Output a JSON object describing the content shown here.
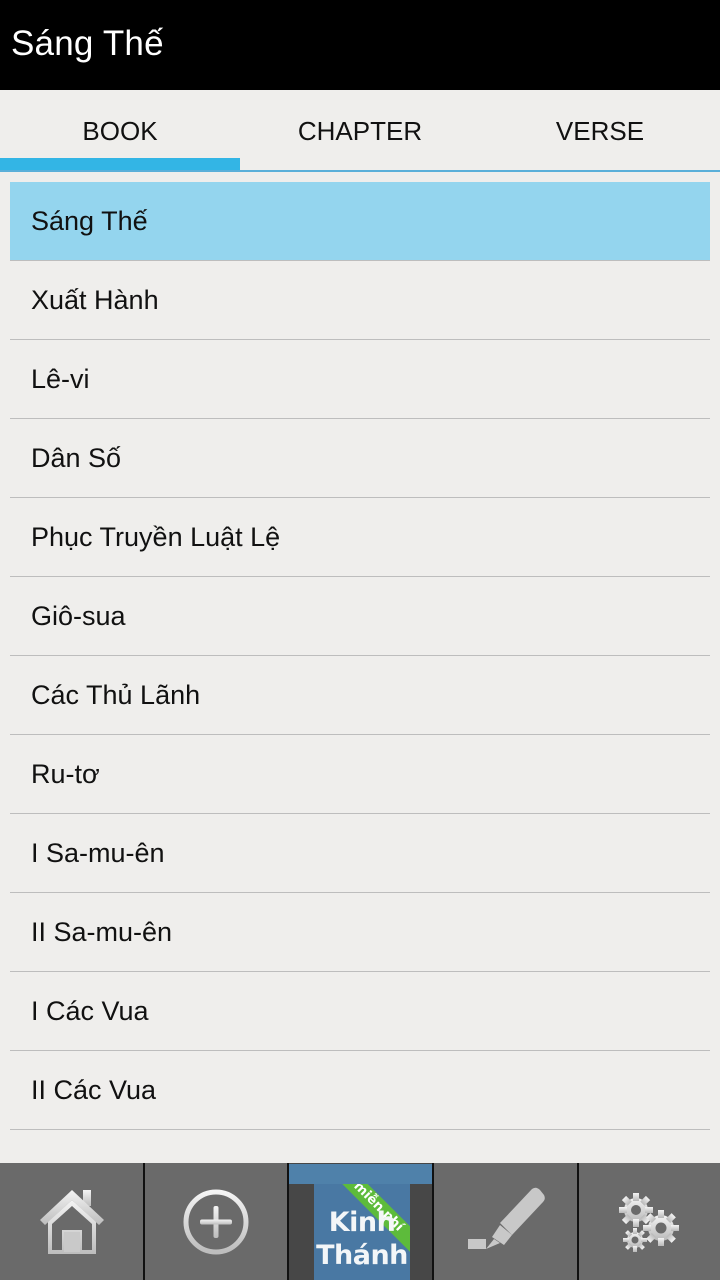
{
  "header": {
    "title": "Sáng Thế"
  },
  "tabs": [
    {
      "label": "BOOK",
      "active": true
    },
    {
      "label": "CHAPTER",
      "active": false
    },
    {
      "label": "VERSE",
      "active": false
    }
  ],
  "colors": {
    "accent": "#33b5e5",
    "selected_row": "#94d5ee",
    "header_bg": "#000000",
    "nav_bg": "#6a6a6a",
    "logo_blue": "#4978a3",
    "ribbon_green": "#5dbb3b"
  },
  "books": [
    {
      "name": "Sáng Thế",
      "selected": true
    },
    {
      "name": "Xuất Hành",
      "selected": false
    },
    {
      "name": "Lê-vi",
      "selected": false
    },
    {
      "name": "Dân Số",
      "selected": false
    },
    {
      "name": "Phục Truyền Luật Lệ",
      "selected": false
    },
    {
      "name": "Giô-sua",
      "selected": false
    },
    {
      "name": "Các Thủ Lãnh",
      "selected": false
    },
    {
      "name": "Ru-tơ",
      "selected": false
    },
    {
      "name": "I Sa-mu-ên",
      "selected": false
    },
    {
      "name": "II Sa-mu-ên",
      "selected": false
    },
    {
      "name": "I Các Vua",
      "selected": false
    },
    {
      "name": "II Các Vua",
      "selected": false
    }
  ],
  "bottom_nav": {
    "items": [
      {
        "icon": "home-icon"
      },
      {
        "icon": "add-circle-icon"
      },
      {
        "icon": "bible-logo-icon",
        "active": true
      },
      {
        "icon": "highlighter-icon"
      },
      {
        "icon": "gears-icon"
      }
    ],
    "logo": {
      "line1": "Kinh",
      "line2": "Thánh",
      "ribbon": "miễn phí"
    }
  }
}
